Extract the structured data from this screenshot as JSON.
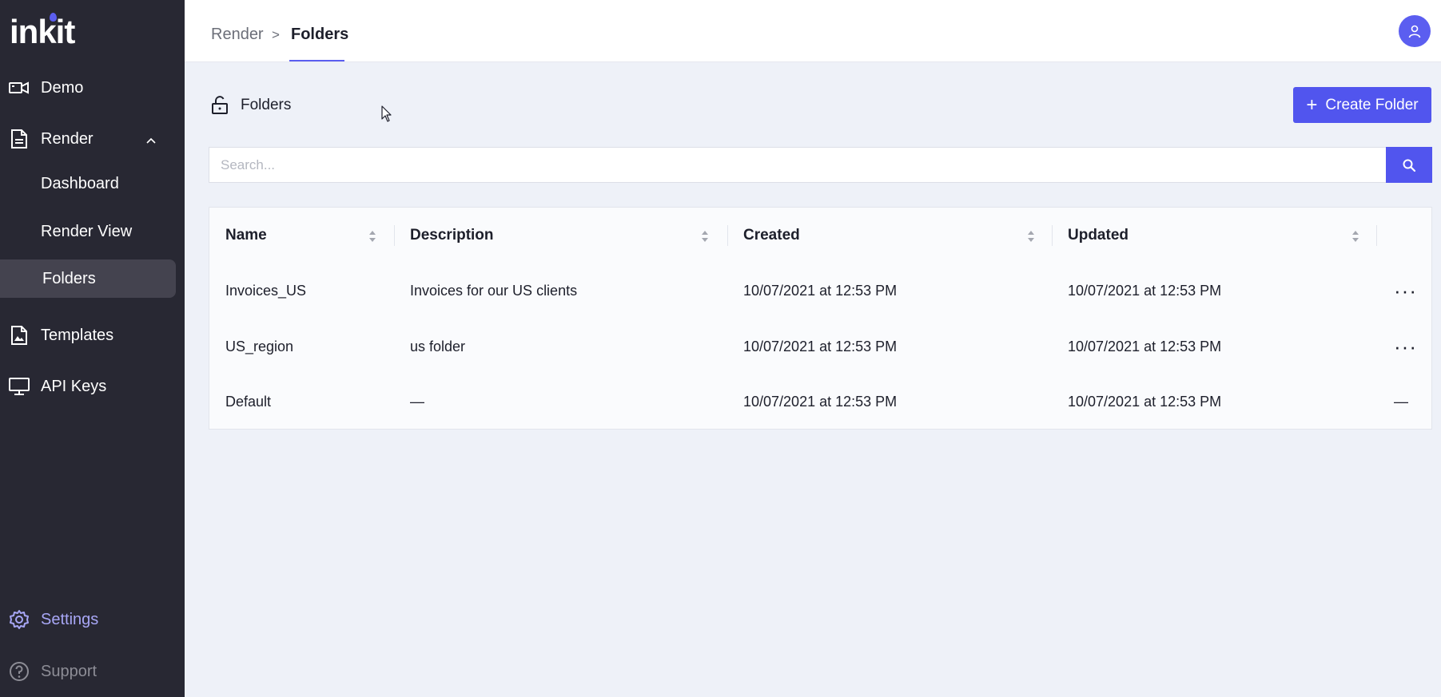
{
  "app": {
    "logo": "inkit"
  },
  "sidebar": {
    "items": [
      {
        "label": "Demo",
        "icon": "video-camera-icon"
      },
      {
        "label": "Render",
        "icon": "document-icon"
      },
      {
        "label": "Templates",
        "icon": "image-document-icon"
      },
      {
        "label": "API Keys",
        "icon": "monitor-icon"
      }
    ],
    "render_sub": [
      {
        "label": "Dashboard"
      },
      {
        "label": "Render View"
      },
      {
        "label": "Folders",
        "active": true
      }
    ],
    "settings": {
      "label": "Settings",
      "icon": "gear-icon"
    },
    "support": {
      "label": "Support",
      "icon": "help-circle-icon"
    }
  },
  "header": {
    "breadcrumb": {
      "parent": "Render",
      "separator": ">",
      "current": "Folders"
    }
  },
  "page": {
    "title": "Folders",
    "create_button": "Create Folder",
    "search_placeholder": "Search..."
  },
  "table": {
    "columns": [
      "Name",
      "Description",
      "Created",
      "Updated"
    ],
    "rows": [
      {
        "name": "Invoices_US",
        "description": "Invoices for our US clients",
        "created": "10/07/2021 at 12:53 PM",
        "updated": "10/07/2021 at 12:53 PM",
        "action": "···"
      },
      {
        "name": "US_region",
        "description": "us folder",
        "created": "10/07/2021 at 12:53 PM",
        "updated": "10/07/2021 at 12:53 PM",
        "action": "···"
      },
      {
        "name": "Default",
        "description": "—",
        "created": "10/07/2021 at 12:53 PM",
        "updated": "10/07/2021 at 12:53 PM",
        "action": "—"
      }
    ]
  },
  "colors": {
    "accent": "#5155ee",
    "sidebar_bg": "#282833",
    "page_bg": "#eef1f8",
    "settings_text": "#a8a7f6"
  }
}
